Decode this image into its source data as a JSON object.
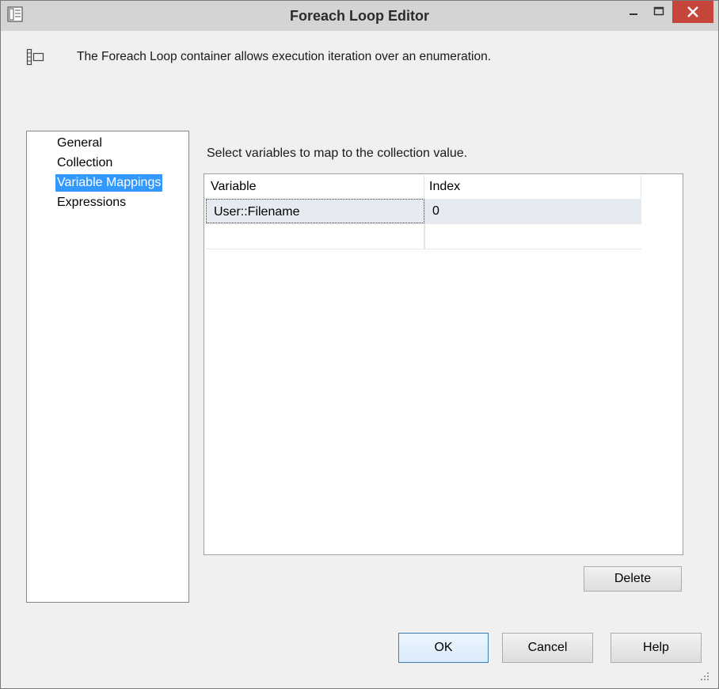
{
  "window": {
    "title": "Foreach Loop Editor",
    "close_glyph": "✕",
    "min_glyph": "–",
    "max_glyph": "□"
  },
  "header": {
    "icon": "foreach-container-icon",
    "description": "The Foreach Loop container allows execution iteration over an enumeration."
  },
  "nav": {
    "items": [
      {
        "label": "General",
        "selected": false
      },
      {
        "label": "Collection",
        "selected": false
      },
      {
        "label": "Variable Mappings",
        "selected": true
      },
      {
        "label": "Expressions",
        "selected": false
      }
    ]
  },
  "mappings": {
    "prompt": "Select variables to map to the collection value.",
    "columns": [
      "Variable",
      "Index"
    ],
    "rows": [
      {
        "variable": "User::Filename",
        "index": "0"
      }
    ]
  },
  "buttons": {
    "delete": "Delete",
    "ok": "OK",
    "cancel": "Cancel",
    "help": "Help"
  },
  "colors": {
    "selection": "#3399ff",
    "close_button": "#c7463c",
    "title_bar": "#d4d4d4"
  }
}
